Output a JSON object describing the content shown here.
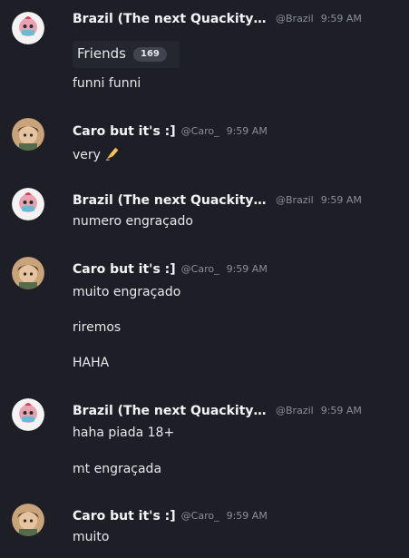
{
  "users": {
    "brazil": {
      "name": "Brazil (The next Quackity)...",
      "handle": "@Brazil"
    },
    "caro": {
      "name": "Caro but it's :]",
      "handle": "@Caro_"
    }
  },
  "messages": [
    {
      "time": "9:59 AM",
      "embed": {
        "label": "Friends",
        "count": "169"
      },
      "lines": [
        "funni funni"
      ]
    },
    {
      "time": "9:59 AM",
      "lines": [
        "very"
      ],
      "emoji": "writing-hand-icon"
    },
    {
      "time": "9:59 AM",
      "lines": [
        "numero engraçado"
      ]
    },
    {
      "time": "9:59 AM",
      "lines": [
        "muito engraçado",
        "riremos",
        "HAHA"
      ]
    },
    {
      "time": "9:59 AM",
      "lines": [
        "haha piada 18+",
        "mt engraçada"
      ]
    },
    {
      "time": "9:59 AM",
      "lines": [
        "muito"
      ]
    }
  ]
}
